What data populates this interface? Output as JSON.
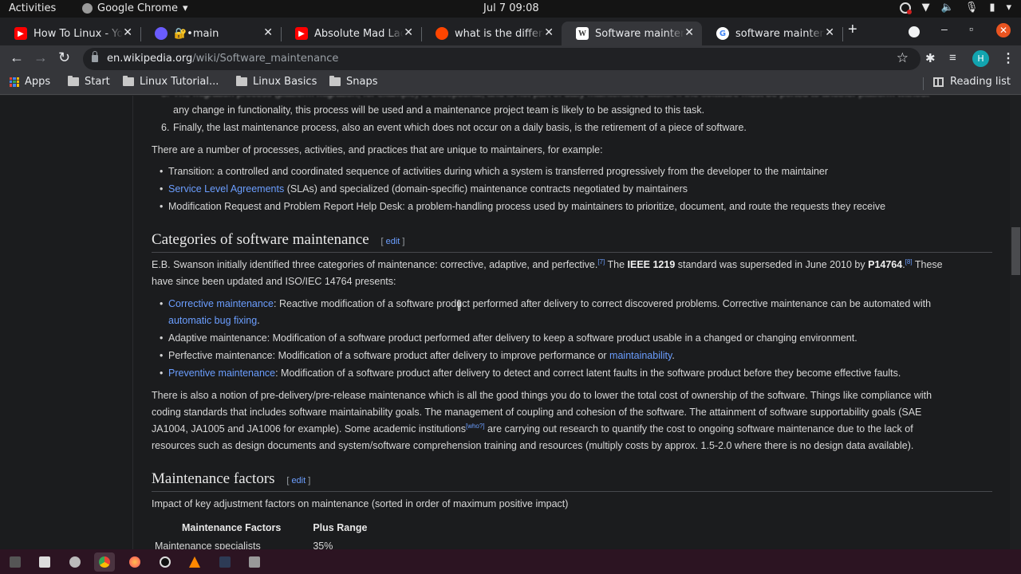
{
  "system_bar": {
    "activities": "Activities",
    "app_name": "Google Chrome",
    "clock": "Jul 7  09:08"
  },
  "tabs": [
    {
      "label": "How To Linux - YouTube",
      "favicon": "youtube-icon",
      "color": "#ff0000"
    },
    {
      "label": "🔐•main",
      "favicon": "app-icon",
      "color": "#6a5cff"
    },
    {
      "label": "Absolute Mad Lad",
      "favicon": "youtube-icon",
      "color": "#ff0000"
    },
    {
      "label": "what is the difference",
      "favicon": "reddit-icon",
      "color": "#ff4500"
    },
    {
      "label": "Software maintenance",
      "favicon": "wikipedia-icon",
      "color": "#ffffff",
      "active": true
    },
    {
      "label": "software maintenance",
      "favicon": "google-icon",
      "color": "#4285f4"
    }
  ],
  "toolbar": {
    "url_domain": "en.wikipedia.org",
    "url_path": "/wiki/Software_maintenance",
    "avatar_initial": "H"
  },
  "bookmarks": {
    "items": [
      "Apps",
      "Start",
      "Linux Tutorial...",
      "Linux Basics",
      "Snaps"
    ],
    "reading_list": "Reading list"
  },
  "article": {
    "list5_partial": "The migration process (platform migration, for example) is exceptional, and is not part of daily maintenance tasks. If the software must be ported to another platform without",
    "list5_cont": "any change in functionality, this process will be used and a maintenance project team is likely to be assigned to this task.",
    "list6_num": "6.",
    "list6": "Finally, the last maintenance process, also an event which does not occur on a daily basis, is the retirement of a piece of software.",
    "processes_intro": "There are a number of processes, activities, and practices that are unique to maintainers, for example:",
    "processes": [
      {
        "text": "Transition: a controlled and coordinated sequence of activities during which a system is transferred progressively from the developer to the maintainer"
      },
      {
        "link": "Service Level Agreements",
        "text": " (SLAs) and specialized (domain-specific) maintenance contracts negotiated by maintainers"
      },
      {
        "text": "Modification Request and Problem Report Help Desk: a problem-handling process used by maintainers to prioritize, document, and route the requests they receive"
      }
    ],
    "categories_heading": "Categories of software maintenance",
    "edit_label": "edit",
    "swanson_1": "E.B. Swanson initially identified three categories of maintenance: corrective, adaptive, and perfective.",
    "ref7": "[7]",
    "swanson_2": " The ",
    "ieee": "IEEE 1219",
    "swanson_3": " standard was superseded in June 2010 by ",
    "p14764": "P14764",
    "ref8": "[8]",
    "swanson_4": " These",
    "swanson_line2": "have since been updated and ISO/IEC 14764 presents:",
    "categories": [
      {
        "link": "Corrective maintenance",
        "text": ": Reactive modification of a software product performed after delivery to correct discovered problems. Corrective maintenance can be automated with",
        "link2": "automatic bug fixing",
        "tail": "."
      },
      {
        "text": "Adaptive maintenance: Modification of a software product performed after delivery to keep a software product usable in a changed or changing environment."
      },
      {
        "text": "Perfective maintenance: Modification of a software product after delivery to improve performance or ",
        "link": "maintainability",
        "tail": "."
      },
      {
        "link": "Preventive maintenance",
        "text": ": Modification of a software product after delivery to detect and correct latent faults in the software product before they become effective faults."
      }
    ],
    "predelivery_l1": "There is also a notion of pre-delivery/pre-release maintenance which is all the good things you do to lower the total cost of ownership of the software. Things like compliance with",
    "predelivery_l2": "coding standards that includes software maintainability goals. The management of coupling and cohesion of the software. The attainment of software supportability goals (SAE",
    "predelivery_l3a": "JA1004, JA1005 and JA1006 for example). Some academic institutions",
    "who_ref": "[who?]",
    "predelivery_l3b": " are carrying out research to quantify the cost to ongoing software maintenance due to the lack of",
    "predelivery_l4": "resources such as design documents and system/software comprehension training and resources (multiply costs by approx. 1.5-2.0 where there is no design data available).",
    "factors_heading": "Maintenance factors",
    "factors_intro": "Impact of key adjustment factors on maintenance (sorted in order of maximum positive impact)",
    "factors_table": {
      "headers": [
        "Maintenance Factors",
        "Plus Range"
      ],
      "rows": [
        [
          "Maintenance specialists",
          "35%"
        ]
      ]
    }
  },
  "dock": [
    "terminal-icon",
    "files-icon",
    "settings-icon",
    "chrome-icon",
    "firefox-icon",
    "obs-icon",
    "vlc-icon",
    "photoshop-icon",
    "trash-icon"
  ]
}
